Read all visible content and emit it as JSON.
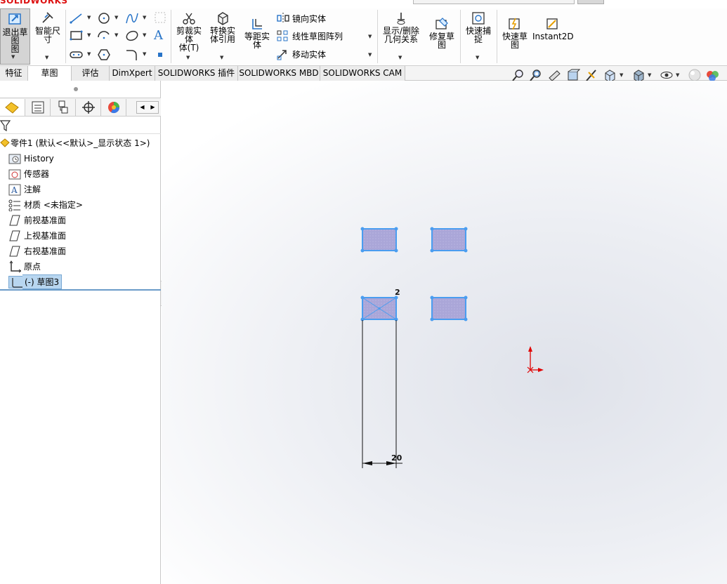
{
  "app": {
    "logo_text": "SOLIDWORKS"
  },
  "toolbar": {
    "exit_sketch": "退出草图",
    "smart_dimension": "智能尺寸",
    "trim_entities": "剪裁实体",
    "trim_sub": "体(T)",
    "convert_entities": "转换实",
    "convert_sub": "体引用",
    "offset_entities": "等距实",
    "offset_sub": "体",
    "mirror_entities": "镜向实体",
    "linear_pattern": "线性草图阵列",
    "move_entities": "移动实体",
    "display_delete_relations": "显示/删除",
    "display_delete_sub": "几何关系",
    "repair_sketch": "修复草",
    "repair_sub": "图",
    "quick_snaps": "快速捕",
    "quick_snaps_sub": "捉",
    "rapid_sketch": "快速草",
    "rapid_sub": "图",
    "instant2d": "Instant2D"
  },
  "tabs": [
    {
      "label": "特征",
      "active": false
    },
    {
      "label": "草图",
      "active": true
    },
    {
      "label": "评估",
      "active": false
    },
    {
      "label": "DimXpert",
      "active": false
    },
    {
      "label": "SOLIDWORKS 插件",
      "active": false
    },
    {
      "label": "SOLIDWORKS MBD",
      "active": false
    },
    {
      "label": "SOLIDWORKS CAM",
      "active": false
    }
  ],
  "feature_tree": {
    "root": "零件1 (默认<<默认>_显示状态 1>)",
    "items": [
      {
        "label": "History",
        "icon": "history-folder-icon",
        "expandable": true
      },
      {
        "label": "传感器",
        "icon": "sensor-icon",
        "expandable": false
      },
      {
        "label": "注解",
        "icon": "annotation-icon",
        "expandable": true
      },
      {
        "label": "材质 <未指定>",
        "icon": "material-icon",
        "expandable": false
      },
      {
        "label": "前视基准面",
        "icon": "plane-icon",
        "expandable": false
      },
      {
        "label": "上视基准面",
        "icon": "plane-icon",
        "expandable": false
      },
      {
        "label": "右视基准面",
        "icon": "plane-icon",
        "expandable": false
      },
      {
        "label": "原点",
        "icon": "origin-icon",
        "expandable": false
      },
      {
        "label": "(-) 草图3",
        "icon": "sketch-icon",
        "expandable": false,
        "selected": true
      }
    ]
  },
  "sketch": {
    "dimension_vertical": "2",
    "dimension_horizontal": "20",
    "sketch_color": "#4a9df0",
    "fill_color": "#a9a6d6",
    "origin_color": "#e00000"
  }
}
